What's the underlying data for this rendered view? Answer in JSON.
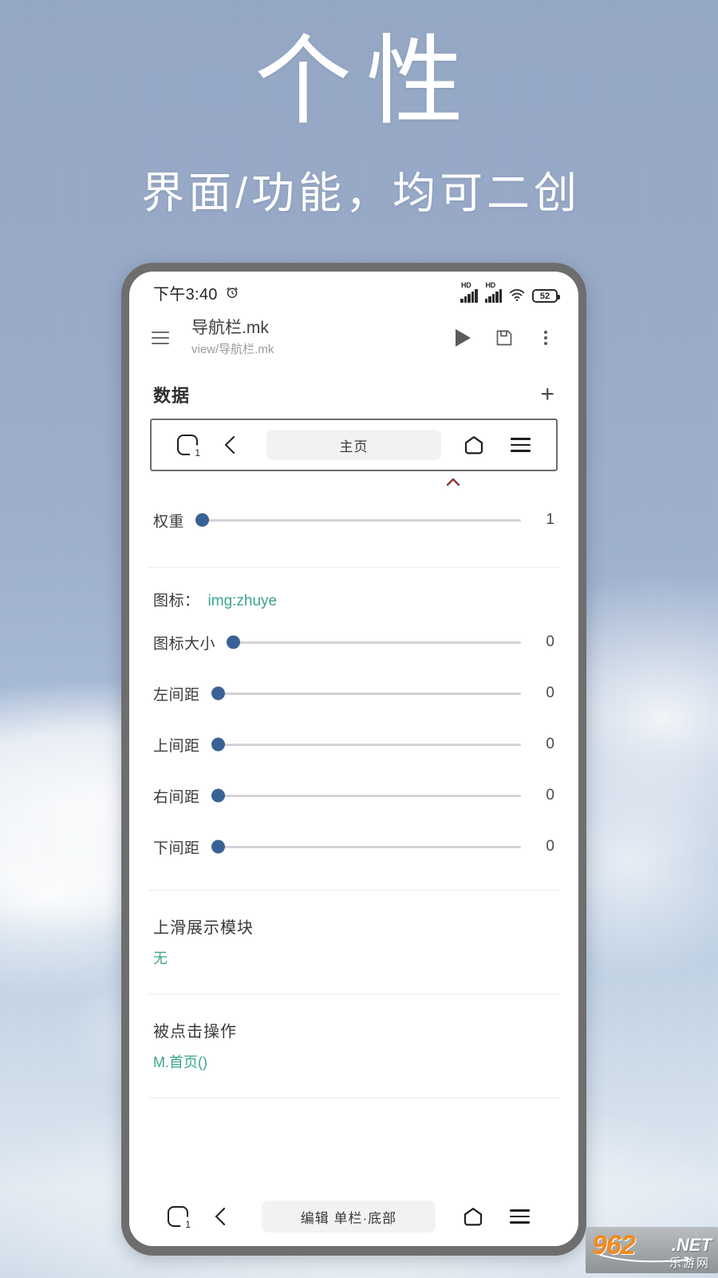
{
  "hero": {
    "title": "个性",
    "subtitle": "界面/功能，均可二创"
  },
  "phone": {
    "statusbar": {
      "time": "下午3:40",
      "alarm_icon": "alarm-clock-icon",
      "signal_label_1": "HD",
      "signal_label_2": "HD",
      "wifi_icon": "wifi-icon",
      "battery": "52"
    },
    "appbar": {
      "menu_icon": "hamburger-menu-icon",
      "title": "导航栏.mk",
      "subtitle": "view/导航栏.mk",
      "run_icon": "play-icon",
      "save_icon": "save-disk-icon",
      "more_icon": "more-vertical-icon"
    },
    "section": {
      "title": "数据",
      "add_label": "+"
    },
    "preview_nav": {
      "recents_icon": "recent-apps-icon",
      "recents_badge": "1",
      "back_icon": "chevron-back-icon",
      "pill_label": "主页",
      "home_icon": "home-pentagon-icon",
      "menu_icon": "hamburger-menu-icon"
    },
    "rows": [
      {
        "label": "权重",
        "value": "1",
        "thumb_pct": 0
      },
      {
        "label": "图标大小",
        "value": "0",
        "thumb_pct": 0
      },
      {
        "label": "左间距",
        "value": "0",
        "thumb_pct": 0
      },
      {
        "label": "上间距",
        "value": "0",
        "thumb_pct": 0
      },
      {
        "label": "右间距",
        "value": "0",
        "thumb_pct": 0
      },
      {
        "label": "下间距",
        "value": "0",
        "thumb_pct": 0
      }
    ],
    "icon_field": {
      "key": "图标：",
      "value": "img:zhuye"
    },
    "blocks": [
      {
        "title": "上滑展示模块",
        "value": "无"
      },
      {
        "title": "被点击操作",
        "value": "M.首页()"
      }
    ],
    "sysnav": {
      "recents_icon": "recent-apps-icon",
      "recents_badge": "1",
      "back_icon": "chevron-back-icon",
      "pill_label": "编辑 单栏·底部",
      "home_icon": "home-pentagon-icon",
      "menu_icon": "hamburger-menu-icon"
    }
  },
  "watermark": {
    "number": "962",
    "tld": ".NET",
    "cn": "乐游网"
  },
  "colors": {
    "sky_top": "#93a6c4",
    "accent_teal": "#3aa68f",
    "slider_thumb": "#3a6195",
    "caret_red": "#8b3a3a",
    "phone_frame": "#6e6e6e"
  }
}
